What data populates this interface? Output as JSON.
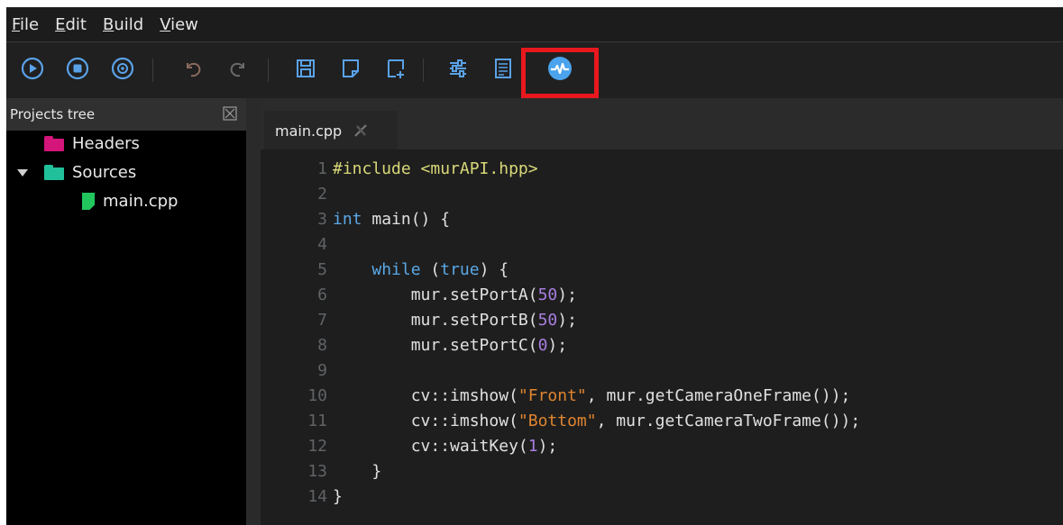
{
  "menu": {
    "items": [
      {
        "mnemonic": "F",
        "rest": "ile"
      },
      {
        "mnemonic": "E",
        "rest": "dit"
      },
      {
        "mnemonic": "B",
        "rest": "uild"
      },
      {
        "mnemonic": "V",
        "rest": "iew"
      }
    ]
  },
  "toolbar": {
    "icons": [
      "run-icon",
      "stop-icon",
      "debug-icon",
      "undo-icon",
      "redo-icon",
      "save-icon",
      "new-file-icon",
      "add-file-icon",
      "settings-sliders-icon",
      "log-icon",
      "monitor-icon"
    ],
    "highlight_color": "#e8181e"
  },
  "projects_tree": {
    "title": "Projects tree",
    "items": [
      {
        "label": "Headers",
        "type": "folder",
        "color": "#d4157a"
      },
      {
        "label": "Sources",
        "type": "folder",
        "color": "#20c19a"
      },
      {
        "label": "main.cpp",
        "type": "file",
        "color": "#21c75d"
      }
    ]
  },
  "editor": {
    "tab_label": "main.cpp",
    "lines": [
      {
        "n": "1",
        "tokens": [
          [
            "pre",
            "#include <murAPI.hpp>"
          ]
        ]
      },
      {
        "n": "2",
        "tokens": []
      },
      {
        "n": "3",
        "tokens": [
          [
            "kw",
            "int"
          ],
          [
            "t",
            " main() {"
          ]
        ]
      },
      {
        "n": "4",
        "tokens": []
      },
      {
        "n": "5",
        "tokens": [
          [
            "t",
            "    "
          ],
          [
            "kw",
            "while"
          ],
          [
            "t",
            " ("
          ],
          [
            "kw",
            "true"
          ],
          [
            "t",
            ") {"
          ]
        ]
      },
      {
        "n": "6",
        "tokens": [
          [
            "t",
            "        mur.setPortA("
          ],
          [
            "num",
            "50"
          ],
          [
            "t",
            ");"
          ]
        ]
      },
      {
        "n": "7",
        "tokens": [
          [
            "t",
            "        mur.setPortB("
          ],
          [
            "num",
            "50"
          ],
          [
            "t",
            ");"
          ]
        ]
      },
      {
        "n": "8",
        "tokens": [
          [
            "t",
            "        mur.setPortC("
          ],
          [
            "num",
            "0"
          ],
          [
            "t",
            ");"
          ]
        ]
      },
      {
        "n": "9",
        "tokens": []
      },
      {
        "n": "10",
        "tokens": [
          [
            "t",
            "        cv::imshow("
          ],
          [
            "str",
            "\"Front\""
          ],
          [
            "t",
            ", mur.getCameraOneFrame());"
          ]
        ]
      },
      {
        "n": "11",
        "tokens": [
          [
            "t",
            "        cv::imshow("
          ],
          [
            "str",
            "\"Bottom\""
          ],
          [
            "t",
            ", mur.getCameraTwoFrame());"
          ]
        ]
      },
      {
        "n": "12",
        "tokens": [
          [
            "t",
            "        cv::waitKey("
          ],
          [
            "num",
            "1"
          ],
          [
            "t",
            ");"
          ]
        ]
      },
      {
        "n": "13",
        "tokens": [
          [
            "t",
            "    }"
          ]
        ]
      },
      {
        "n": "14",
        "tokens": [
          [
            "t",
            "}"
          ]
        ]
      }
    ]
  }
}
